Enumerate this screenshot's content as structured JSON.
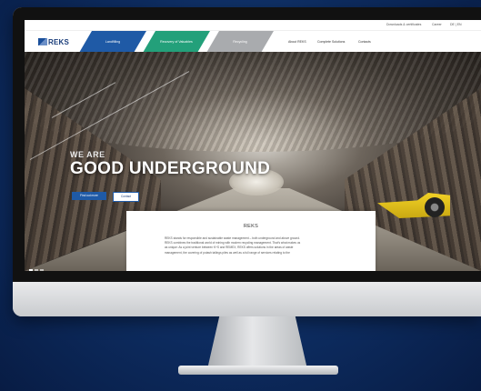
{
  "utility": {
    "downloads": "Downloads & certificates",
    "career": "Career",
    "language": "DE | EN"
  },
  "brand": {
    "logo_text": "REKS"
  },
  "nav": {
    "tabs": [
      {
        "label": "Landfilling"
      },
      {
        "label": "Recovery of Valuables"
      },
      {
        "label": "Recycling"
      }
    ],
    "links": [
      {
        "label": "About REKS"
      },
      {
        "label": "Complete Solutions"
      },
      {
        "label": "Contacts"
      }
    ]
  },
  "hero": {
    "subtitle": "WE ARE",
    "title": "GOOD UNDERGROUND",
    "primary_button": "Find out more",
    "secondary_button": "Contact",
    "slide_count": 3,
    "active_slide": 1
  },
  "card": {
    "title": "REKS",
    "lines": [
      "REKS stands for responsible and sustainable waste management – both underground and above ground.",
      "REKS combines the traditional world of mining with modern recycling management. That's what makes us",
      "as unique: As a joint venture between K+S and REMEX, REKS offers solutions in the areas of waste",
      "management, the covering of potash tailings piles as well as a full range of services relating to the"
    ]
  },
  "colors": {
    "brand_blue": "#1f5aa6",
    "brand_green": "#23a07a",
    "tab_gray": "#a9abae",
    "background": "#0c2a5a"
  }
}
